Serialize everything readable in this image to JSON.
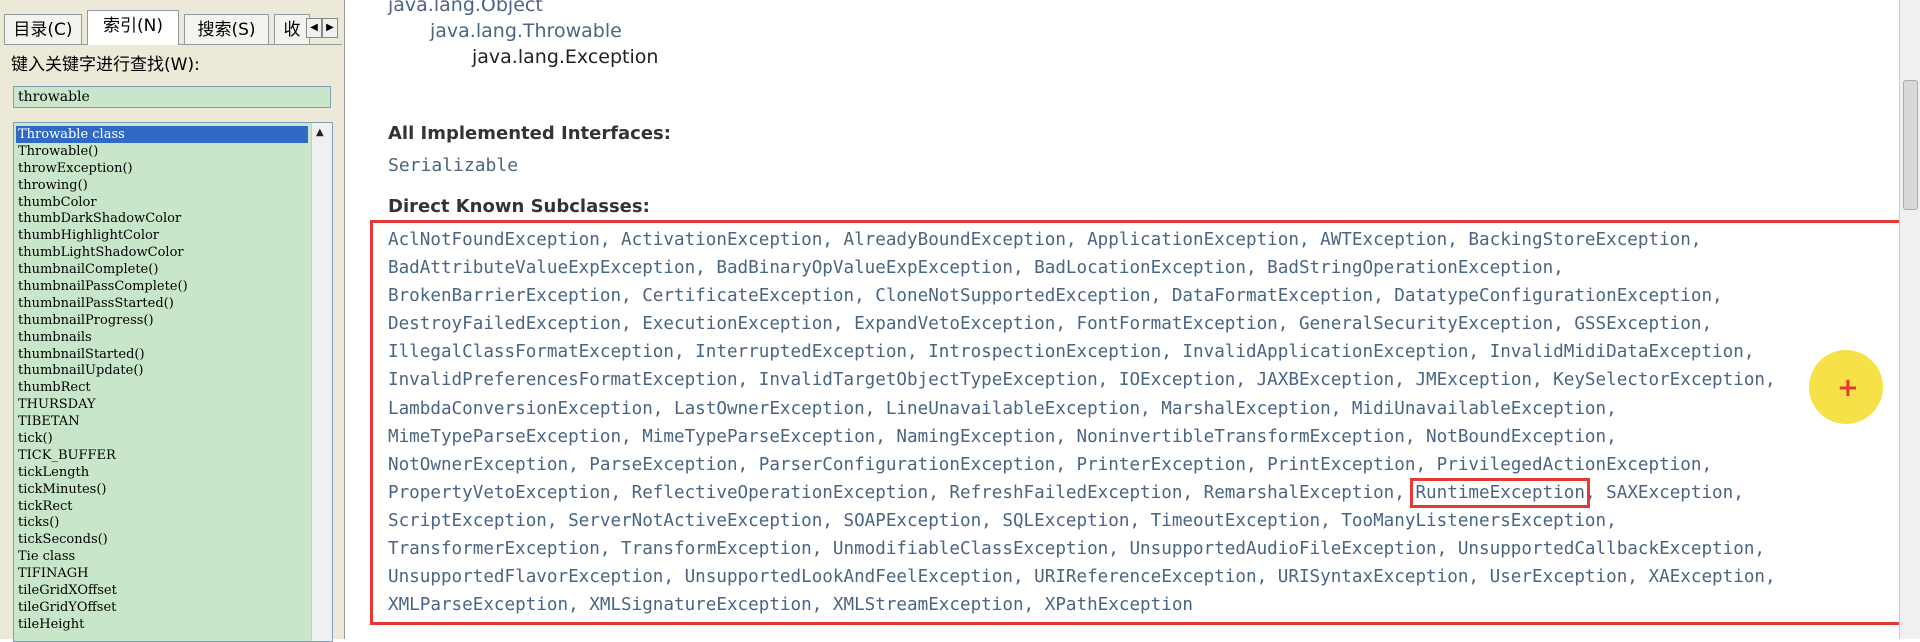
{
  "left": {
    "tabs": [
      {
        "label": "目录(C)",
        "active": false
      },
      {
        "label": "索引(N)",
        "active": true
      },
      {
        "label": "搜索(S)",
        "active": false
      },
      {
        "label": "收",
        "active": false
      }
    ],
    "keyword_label": "键入关键字进行查找(W):",
    "keyword_value": "throwable",
    "items": [
      "Throwable class",
      "Throwable()",
      "throwException()",
      "throwing()",
      "thumbColor",
      "thumbDarkShadowColor",
      "thumbHighlightColor",
      "thumbLightShadowColor",
      "thumbnailComplete()",
      "thumbnailPassComplete()",
      "thumbnailPassStarted()",
      "thumbnailProgress()",
      "thumbnails",
      "thumbnailStarted()",
      "thumbnailUpdate()",
      "thumbRect",
      "THURSDAY",
      "TIBETAN",
      "tick()",
      "TICK_BUFFER",
      "tickLength",
      "tickMinutes()",
      "tickRect",
      "ticks()",
      "tickSeconds()",
      "Tie class",
      "TIFINAGH",
      "tileGridXOffset",
      "tileGridYOffset",
      "tileHeight"
    ],
    "selected_index": 0
  },
  "content": {
    "hierarchy": [
      "java.lang.Object",
      "java.lang.Throwable",
      "java.lang.Exception"
    ],
    "interfaces_heading": "All Implemented Interfaces:",
    "interfaces": "Serializable",
    "subclasses_heading": "Direct Known Subclasses:",
    "subclass_lines": [
      "AclNotFoundException, ActivationException, AlreadyBoundException, ApplicationException, AWTException, BackingStoreException,",
      "BadAttributeValueExpException, BadBinaryOpValueExpException, BadLocationException, BadStringOperationException,",
      "BrokenBarrierException, CertificateException, CloneNotSupportedException, DataFormatException, DatatypeConfigurationException,",
      "DestroyFailedException, ExecutionException, ExpandVetoException, FontFormatException, GeneralSecurityException, GSSException,",
      "IllegalClassFormatException, InterruptedException, IntrospectionException, InvalidApplicationException, InvalidMidiDataException,",
      "InvalidPreferencesFormatException, InvalidTargetObjectTypeException, IOException, JAXBException, JMException, KeySelectorException,",
      "LambdaConversionException, LastOwnerException, LineUnavailableException, MarshalException, MidiUnavailableException,",
      "MimeTypeParseException, MimeTypeParseException, NamingException, NoninvertibleTransformException, NotBoundException,",
      "NotOwnerException, ParseException, ParserConfigurationException, PrinterException, PrintException, PrivilegedActionException,",
      "PropertyVetoException, ReflectiveOperationException, RefreshFailedException, RemarshalException",
      "ScriptException, ServerNotActiveException, SOAPException, SQLException, TimeoutException, TooManyListenersException,",
      "TransformerException, TransformException, UnmodifiableClassException, UnsupportedAudioFileException, UnsupportedCallbackException,",
      "UnsupportedFlavorException, UnsupportedLookAndFeelException, URIReferenceException, URISyntaxException, UserException, XAException,",
      "XMLParseException, XMLSignatureException, XMLStreamException, XPathException"
    ],
    "highlighted_subclass": "RuntimeException",
    "after_highlight": ", SAXException,",
    "comma_sep": ", "
  }
}
